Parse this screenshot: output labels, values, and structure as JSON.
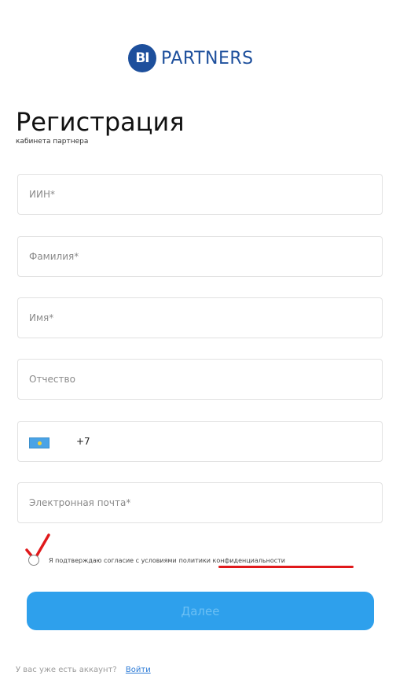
{
  "brand": {
    "badge": "BI",
    "name": "PARTNERS",
    "color": "#1d4f9c"
  },
  "header": {
    "title": "Регистрация",
    "subtitle": "кабинета партнера"
  },
  "fields": [
    {
      "placeholder": "ИИН*",
      "value": ""
    },
    {
      "placeholder": "Фамилия*",
      "value": ""
    },
    {
      "placeholder": "Имя*",
      "value": ""
    },
    {
      "placeholder": "Отчество",
      "value": ""
    }
  ],
  "phone": {
    "flag_icon": "kazakhstan-flag-icon",
    "code": "+7",
    "value": ""
  },
  "email": {
    "placeholder": "Электронная почта*",
    "value": ""
  },
  "consent": {
    "text": "Я подтверждаю согласие с условиями",
    "link": "политики конфиденциальности",
    "checked": false,
    "annotation_color": "#e0191b"
  },
  "submit": {
    "label": "Далее",
    "color": "#2ea0ec"
  },
  "footer": {
    "question": "У вас уже есть аккаунт?",
    "login_link": "Войти"
  }
}
